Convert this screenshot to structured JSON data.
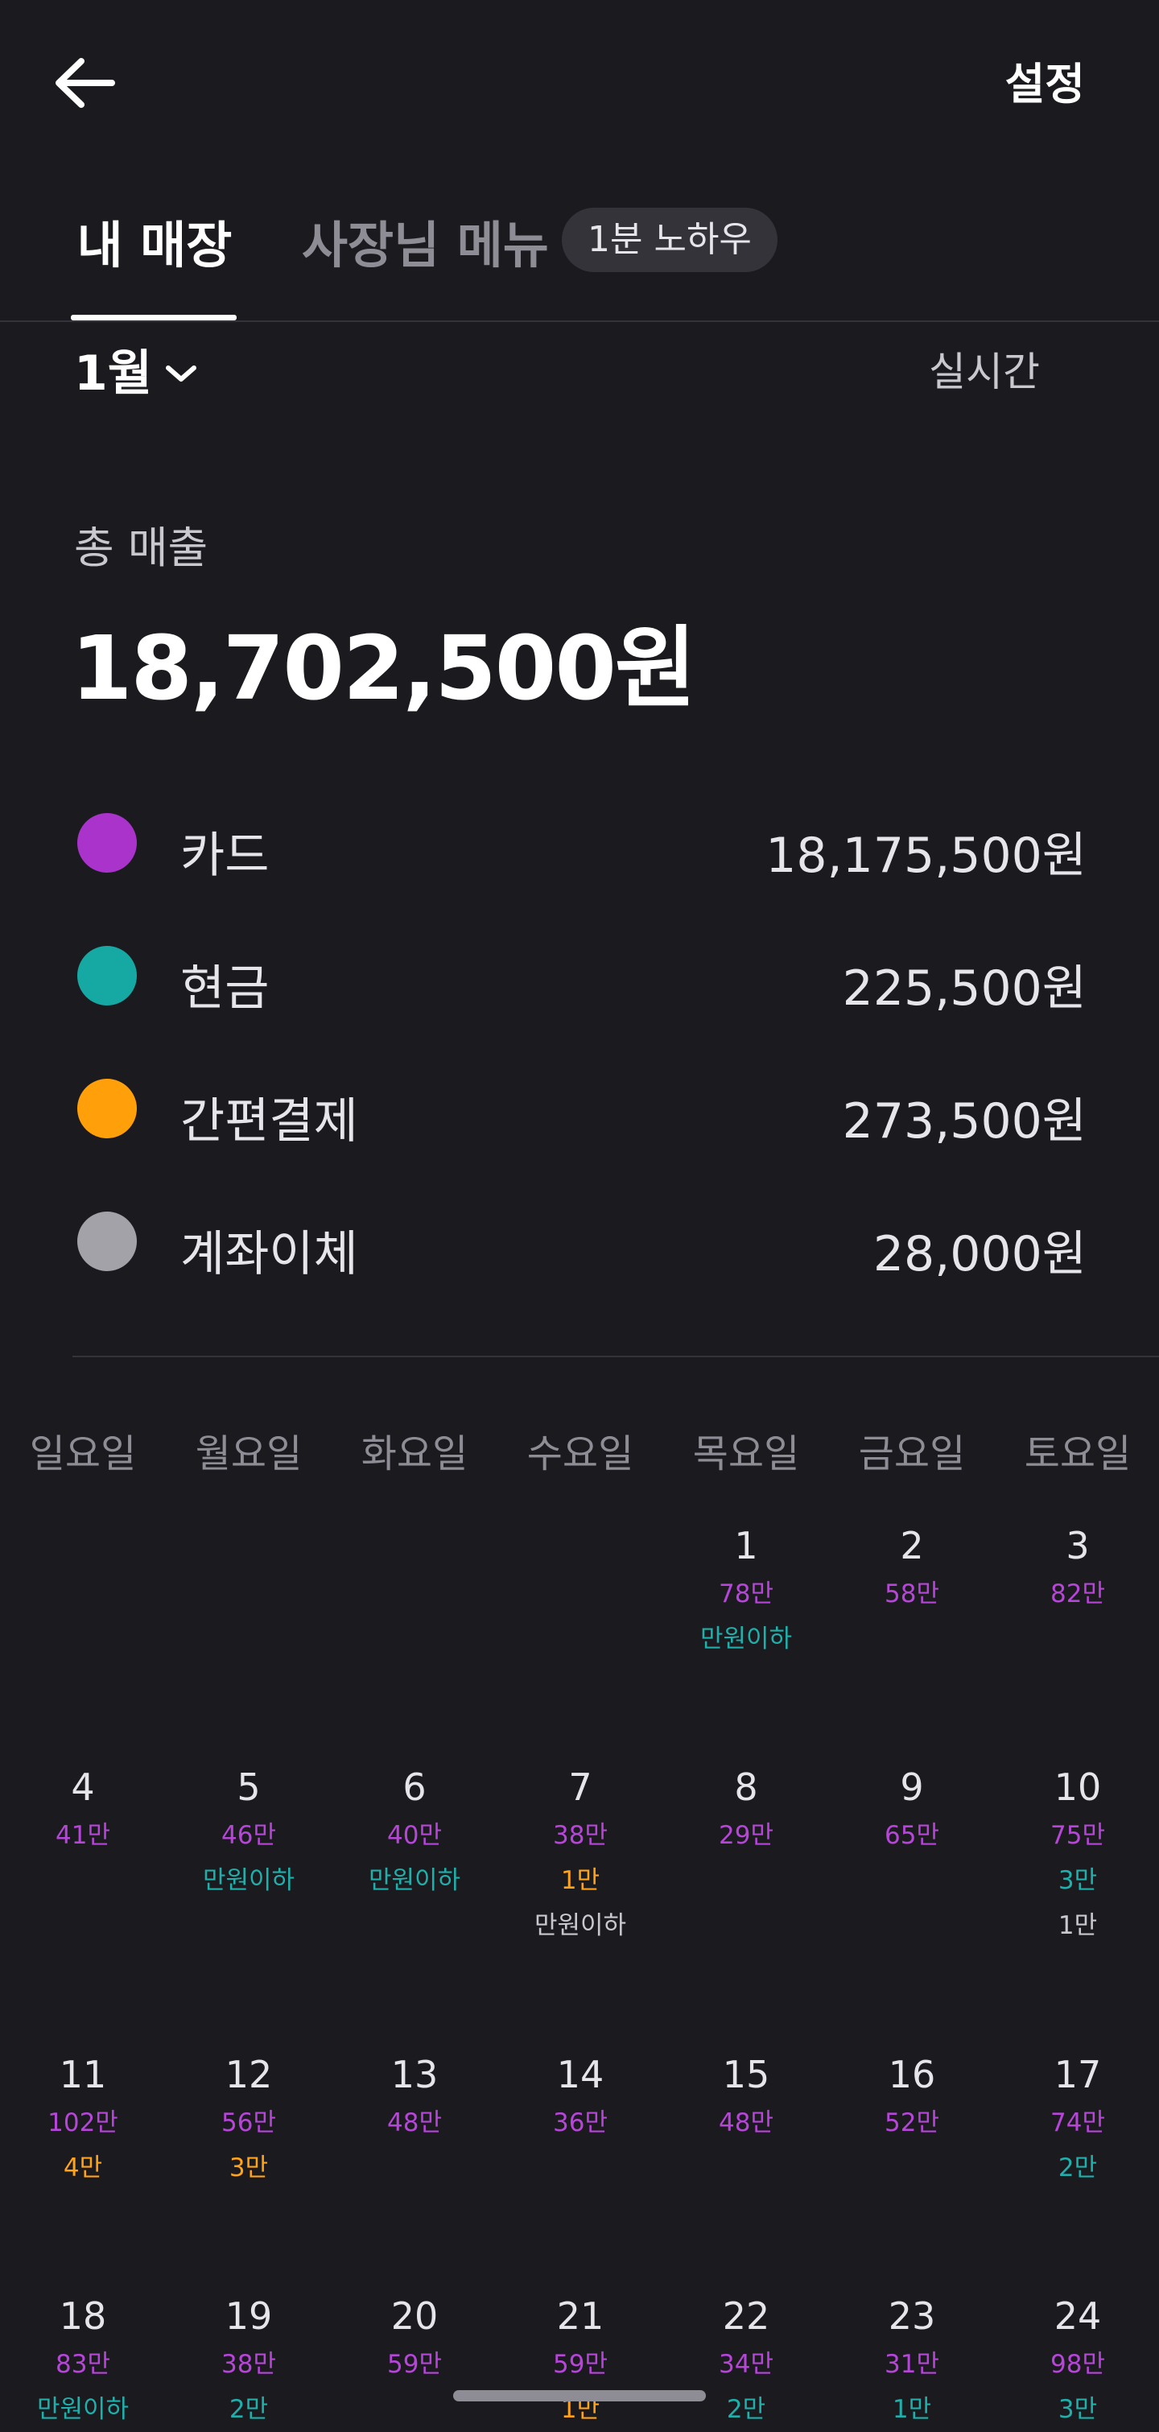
{
  "header": {
    "back_icon": "arrow-left-icon",
    "settings_label": "설정"
  },
  "tabs": {
    "my_store": "내 매장",
    "owner_menu": "사장님 메뉴",
    "badge": "1분 노하우"
  },
  "month": {
    "label": "1월",
    "realtime_label": "실시간"
  },
  "summary": {
    "total_label": "총 매출",
    "total_value": "18,702,500원",
    "payments": [
      {
        "name": "카드",
        "amount": "18,175,500원",
        "color": "#aa33cc"
      },
      {
        "name": "현금",
        "amount": "225,500원",
        "color": "#16a8a3"
      },
      {
        "name": "간편결제",
        "amount": "273,500원",
        "color": "#ff9f0a"
      },
      {
        "name": "계좌이체",
        "amount": "28,000원",
        "color": "#a3a2a8"
      }
    ]
  },
  "calendar": {
    "weekdays": [
      "일요일",
      "월요일",
      "화요일",
      "수요일",
      "목요일",
      "금요일",
      "토요일"
    ],
    "colors": {
      "card": "#b646d8",
      "cash": "#1fb0ab",
      "easy": "#ffa31a",
      "bank": "#c9c8cf"
    },
    "days": [
      {
        "day": "1",
        "lines": [
          {
            "text": "78만",
            "type": "card"
          },
          {
            "text": "만원이하",
            "type": "cash"
          }
        ]
      },
      {
        "day": "2",
        "lines": [
          {
            "text": "58만",
            "type": "card"
          }
        ]
      },
      {
        "day": "3",
        "lines": [
          {
            "text": "82만",
            "type": "card"
          }
        ]
      },
      {
        "day": "4",
        "lines": [
          {
            "text": "41만",
            "type": "card"
          }
        ]
      },
      {
        "day": "5",
        "lines": [
          {
            "text": "46만",
            "type": "card"
          },
          {
            "text": "만원이하",
            "type": "cash"
          }
        ]
      },
      {
        "day": "6",
        "lines": [
          {
            "text": "40만",
            "type": "card"
          },
          {
            "text": "만원이하",
            "type": "cash"
          }
        ]
      },
      {
        "day": "7",
        "lines": [
          {
            "text": "38만",
            "type": "card"
          },
          {
            "text": "1만",
            "type": "easy"
          },
          {
            "text": "만원이하",
            "type": "bank"
          }
        ]
      },
      {
        "day": "8",
        "lines": [
          {
            "text": "29만",
            "type": "card"
          }
        ]
      },
      {
        "day": "9",
        "lines": [
          {
            "text": "65만",
            "type": "card"
          }
        ]
      },
      {
        "day": "10",
        "lines": [
          {
            "text": "75만",
            "type": "card"
          },
          {
            "text": "3만",
            "type": "cash"
          },
          {
            "text": "1만",
            "type": "bank"
          }
        ]
      },
      {
        "day": "11",
        "lines": [
          {
            "text": "102만",
            "type": "card"
          },
          {
            "text": "4만",
            "type": "easy"
          }
        ]
      },
      {
        "day": "12",
        "lines": [
          {
            "text": "56만",
            "type": "card"
          },
          {
            "text": "3만",
            "type": "easy"
          }
        ]
      },
      {
        "day": "13",
        "lines": [
          {
            "text": "48만",
            "type": "card"
          }
        ]
      },
      {
        "day": "14",
        "lines": [
          {
            "text": "36만",
            "type": "card"
          }
        ]
      },
      {
        "day": "15",
        "lines": [
          {
            "text": "48만",
            "type": "card"
          }
        ]
      },
      {
        "day": "16",
        "lines": [
          {
            "text": "52만",
            "type": "card"
          }
        ]
      },
      {
        "day": "17",
        "lines": [
          {
            "text": "74만",
            "type": "card"
          },
          {
            "text": "2만",
            "type": "cash"
          }
        ]
      },
      {
        "day": "18",
        "lines": [
          {
            "text": "83만",
            "type": "card"
          },
          {
            "text": "만원이하",
            "type": "cash"
          }
        ]
      },
      {
        "day": "19",
        "lines": [
          {
            "text": "38만",
            "type": "card"
          },
          {
            "text": "2만",
            "type": "cash"
          }
        ]
      },
      {
        "day": "20",
        "lines": [
          {
            "text": "59만",
            "type": "card"
          }
        ]
      },
      {
        "day": "21",
        "lines": [
          {
            "text": "59만",
            "type": "card"
          },
          {
            "text": "1만",
            "type": "easy"
          }
        ]
      },
      {
        "day": "22",
        "lines": [
          {
            "text": "34만",
            "type": "card"
          },
          {
            "text": "2만",
            "type": "cash"
          }
        ]
      },
      {
        "day": "23",
        "lines": [
          {
            "text": "31만",
            "type": "card"
          },
          {
            "text": "1만",
            "type": "cash"
          }
        ]
      },
      {
        "day": "24",
        "lines": [
          {
            "text": "98만",
            "type": "card"
          },
          {
            "text": "3만",
            "type": "cash"
          }
        ]
      }
    ]
  }
}
